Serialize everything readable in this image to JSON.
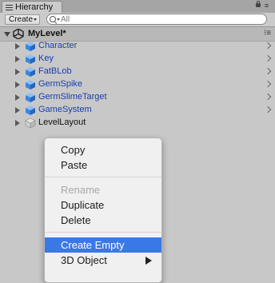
{
  "window": {
    "tab_title": "Hierarchy"
  },
  "toolbar": {
    "create_label": "Create",
    "search_placeholder": "All"
  },
  "scene": {
    "name": "MyLevel*"
  },
  "hierarchy": {
    "items": [
      {
        "label": "Character",
        "type": "prefab",
        "has_chevron": true
      },
      {
        "label": "Key",
        "type": "prefab",
        "has_chevron": true
      },
      {
        "label": "FatBLob",
        "type": "prefab",
        "has_chevron": true
      },
      {
        "label": "GermSpike",
        "type": "prefab",
        "has_chevron": true
      },
      {
        "label": "GermSlimeTarget",
        "type": "prefab",
        "has_chevron": true
      },
      {
        "label": "GameSystem",
        "type": "prefab",
        "has_chevron": true
      },
      {
        "label": "LevelLayout",
        "type": "gameobject",
        "has_chevron": false
      }
    ]
  },
  "context_menu": {
    "copy": "Copy",
    "paste": "Paste",
    "rename": "Rename",
    "duplicate": "Duplicate",
    "delete": "Delete",
    "create_empty": "Create Empty",
    "object_3d": "3D Object"
  },
  "colors": {
    "selection": "#3b78e7",
    "prefab_text": "#1a3eb0"
  }
}
